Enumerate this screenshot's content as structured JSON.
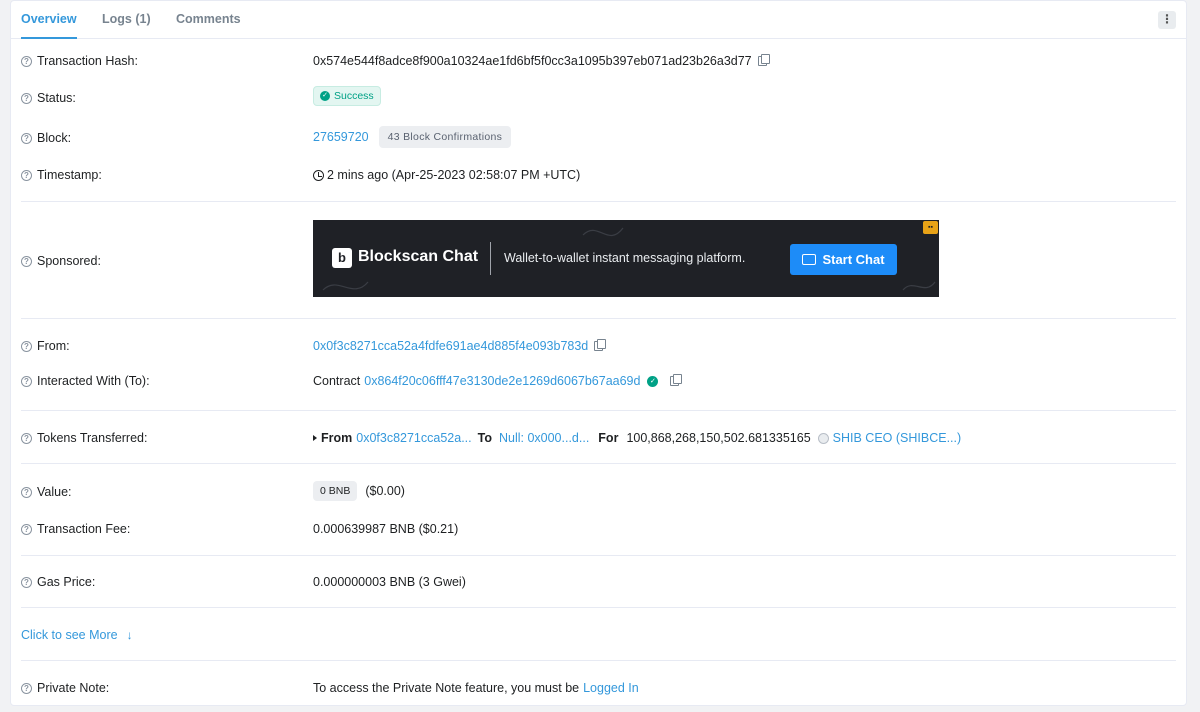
{
  "tabs": {
    "overview": "Overview",
    "logs": "Logs (1)",
    "comments": "Comments",
    "more_icon": "⋮"
  },
  "rows": {
    "tx_hash": {
      "label": "Transaction Hash:",
      "value": "0x574e544f8adce8f900a10324ae1fd6bf5f0cc3a1095b397eb071ad23b26a3d77"
    },
    "status": {
      "label": "Status:",
      "value": "Success"
    },
    "block": {
      "label": "Block:",
      "number": "27659720",
      "confirmations": "43 Block Confirmations"
    },
    "timestamp": {
      "label": "Timestamp:",
      "value": "2 mins ago (Apr-25-2023 02:58:07 PM +UTC)"
    },
    "sponsored": {
      "label": "Sponsored:",
      "brand_letter": "b",
      "brand": "Blockscan Chat",
      "tagline": "Wallet-to-wallet instant messaging platform.",
      "cta": "Start Chat"
    },
    "from": {
      "label": "From:",
      "value": "0x0f3c8271cca52a4fdfe691ae4d885f4e093b783d"
    },
    "to": {
      "label": "Interacted With (To):",
      "prefix": "Contract",
      "value": "0x864f20c06fff47e3130de2e1269d6067b67aa69d"
    },
    "tokens": {
      "label": "Tokens Transferred:",
      "from_label": "From",
      "from_value": "0x0f3c8271cca52a...",
      "to_label": "To",
      "to_value": "Null: 0x000...d...",
      "for_label": "For",
      "amount": "100,868,268,150,502.681335165",
      "token": "SHIB CEO (SHIBCE...)"
    },
    "value": {
      "label": "Value:",
      "amount": "0 BNB",
      "usd": "($0.00)"
    },
    "fee": {
      "label": "Transaction Fee:",
      "value": "0.000639987 BNB ($0.21)"
    },
    "gas": {
      "label": "Gas Price:",
      "value": "0.000000003 BNB (3 Gwei)"
    },
    "more": {
      "label": "Click to see More",
      "arrow": "↓"
    },
    "note": {
      "label": "Private Note:",
      "text": "To access the Private Note feature, you must be",
      "link": "Logged In"
    }
  }
}
